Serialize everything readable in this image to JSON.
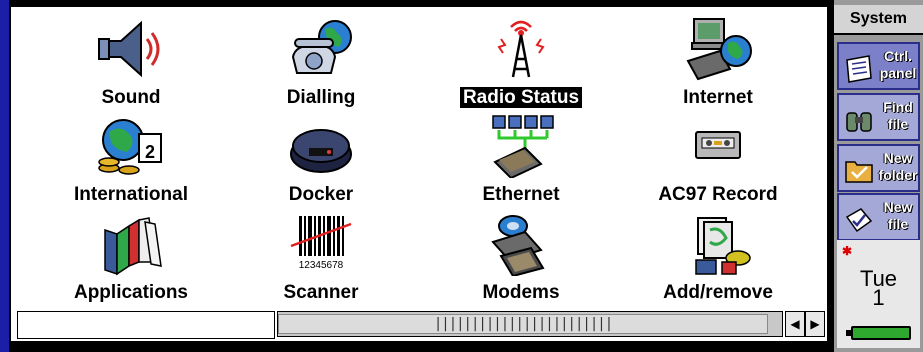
{
  "window": {
    "title": "System"
  },
  "icons": [
    {
      "label": "Sound",
      "icon": "speaker-icon",
      "selected": false
    },
    {
      "label": "Dialling",
      "icon": "telephone-globe-icon",
      "selected": false
    },
    {
      "label": "Radio Status",
      "icon": "radio-tower-icon",
      "selected": true
    },
    {
      "label": "Internet",
      "icon": "computer-globe-icon",
      "selected": false
    },
    {
      "label": "International",
      "icon": "globe-calendar-icon",
      "selected": false
    },
    {
      "label": "Docker",
      "icon": "docking-cradle-icon",
      "selected": false
    },
    {
      "label": "Ethernet",
      "icon": "network-icon",
      "selected": false
    },
    {
      "label": "AC97 Record",
      "icon": "cassette-icon",
      "selected": false
    },
    {
      "label": "Applications",
      "icon": "books-icon",
      "selected": false
    },
    {
      "label": "Scanner",
      "icon": "barcode-icon",
      "selected": false
    },
    {
      "label": "Modems",
      "icon": "modem-icon",
      "selected": false
    },
    {
      "label": "Add/remove",
      "icon": "install-icon",
      "selected": false
    }
  ],
  "barcode_number": "12345678",
  "scrollbar": {
    "thumb_text": "||||||||||||||||||||||||",
    "left_arrow": "◀",
    "right_arrow": "▶"
  },
  "sidebar": {
    "buttons": [
      {
        "line1": "Ctrl.",
        "line2": "panel",
        "icon": "control-panel-icon",
        "active": true
      },
      {
        "line1": "Find",
        "line2": "file",
        "icon": "binoculars-icon",
        "active": false
      },
      {
        "line1": "New",
        "line2": "folder",
        "icon": "folder-icon",
        "active": false
      },
      {
        "line1": "New",
        "line2": "file",
        "icon": "new-file-icon",
        "active": false
      }
    ]
  },
  "clock": {
    "day": "Tue",
    "date": "1"
  },
  "colors": {
    "sidebar_accent": "#2a2e8a",
    "left_bar": "#1a1fa6",
    "battery": "#2fa82f"
  }
}
